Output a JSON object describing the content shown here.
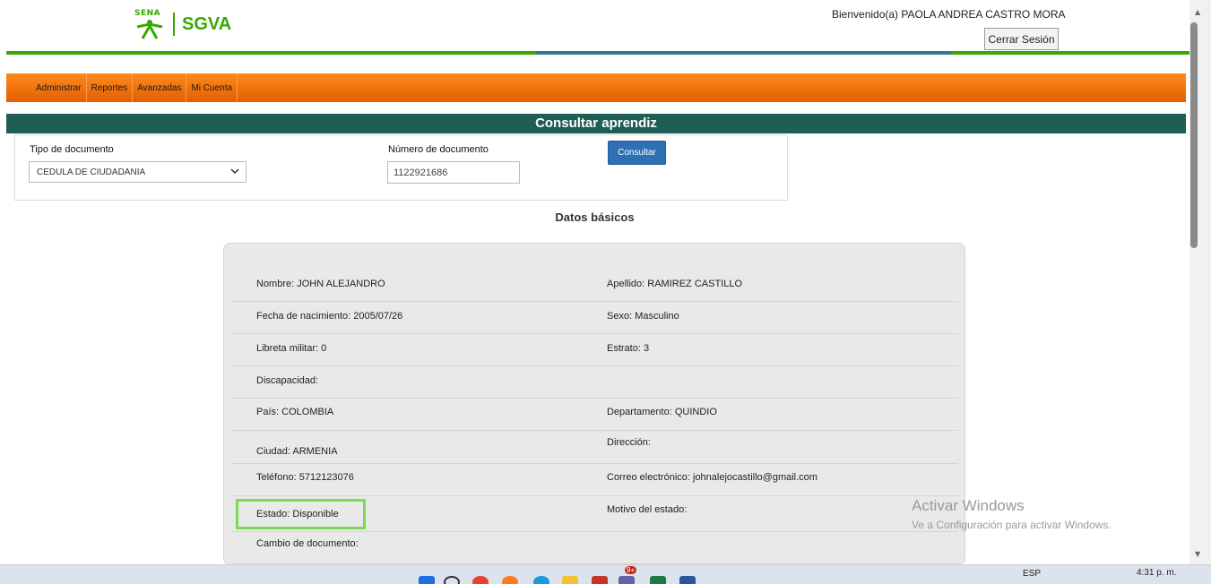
{
  "header": {
    "logo_small": "SENA",
    "logo_text": "SGVA",
    "welcome": "Bienvenido(a) PAOLA ANDREA CASTRO MORA",
    "logout_label": "Cerrar Sesión"
  },
  "nav": {
    "items": [
      {
        "label": "Administrar"
      },
      {
        "label": "Reportes"
      },
      {
        "label": "Avanzadas"
      },
      {
        "label": "Mi Cuenta"
      }
    ]
  },
  "section_title": "Consultar aprendiz",
  "form": {
    "doc_type_label": "Tipo de documento",
    "doc_type_value": "CEDULA DE CIUDADANIA",
    "doc_number_label": "Número de documento",
    "doc_number_value": "1122921686",
    "consult_label": "Consultar"
  },
  "basic_data": {
    "title": "Datos básicos",
    "rows": [
      {
        "left": {
          "label": "Nombre:",
          "value": "JOHN ALEJANDRO"
        },
        "right": {
          "label": "Apellido:",
          "value": "RAMIREZ CASTILLO"
        }
      },
      {
        "left": {
          "label": "Fecha de nacimiento:",
          "value": "2005/07/26"
        },
        "right": {
          "label": "Sexo:",
          "value": "Masculino"
        }
      },
      {
        "left": {
          "label": "Libreta militar:",
          "value": "0"
        },
        "right": {
          "label": "Estrato:",
          "value": "3"
        }
      },
      {
        "left": {
          "label": "Discapacidad:",
          "value": ""
        },
        "right": {
          "label": "",
          "value": ""
        }
      },
      {
        "left": {
          "label": "País:",
          "value": "COLOMBIA"
        },
        "right": {
          "label": "Departamento:",
          "value": "QUINDIO"
        }
      },
      {
        "left": {
          "label": "Ciudad:",
          "value": "ARMENIA"
        },
        "right": {
          "label": "Dirección:",
          "value": ""
        }
      },
      {
        "left": {
          "label": "Teléfono:",
          "value": "5712123076"
        },
        "right": {
          "label": "Correo electrónico:",
          "value": "johnalejocastillo@gmail.com"
        }
      },
      {
        "left": {
          "label": "Estado:",
          "value": "Disponible"
        },
        "right": {
          "label": "Motivo del estado:",
          "value": ""
        }
      },
      {
        "left": {
          "label": "Cambio de documento:",
          "value": ""
        },
        "right": {
          "label": "",
          "value": ""
        }
      }
    ]
  },
  "watermark": {
    "line1": "Activar Windows",
    "line2": "Ve a Configuración para activar Windows."
  },
  "taskbar": {
    "lang": "ESP",
    "time": "4:31 p. m.",
    "badge": "9+"
  },
  "colors": {
    "brand_green": "#39a900",
    "nav_orange": "#f07010",
    "title_teal": "#1e5e55",
    "button_blue": "#2f6fb5",
    "highlight_green": "#7ed957"
  }
}
